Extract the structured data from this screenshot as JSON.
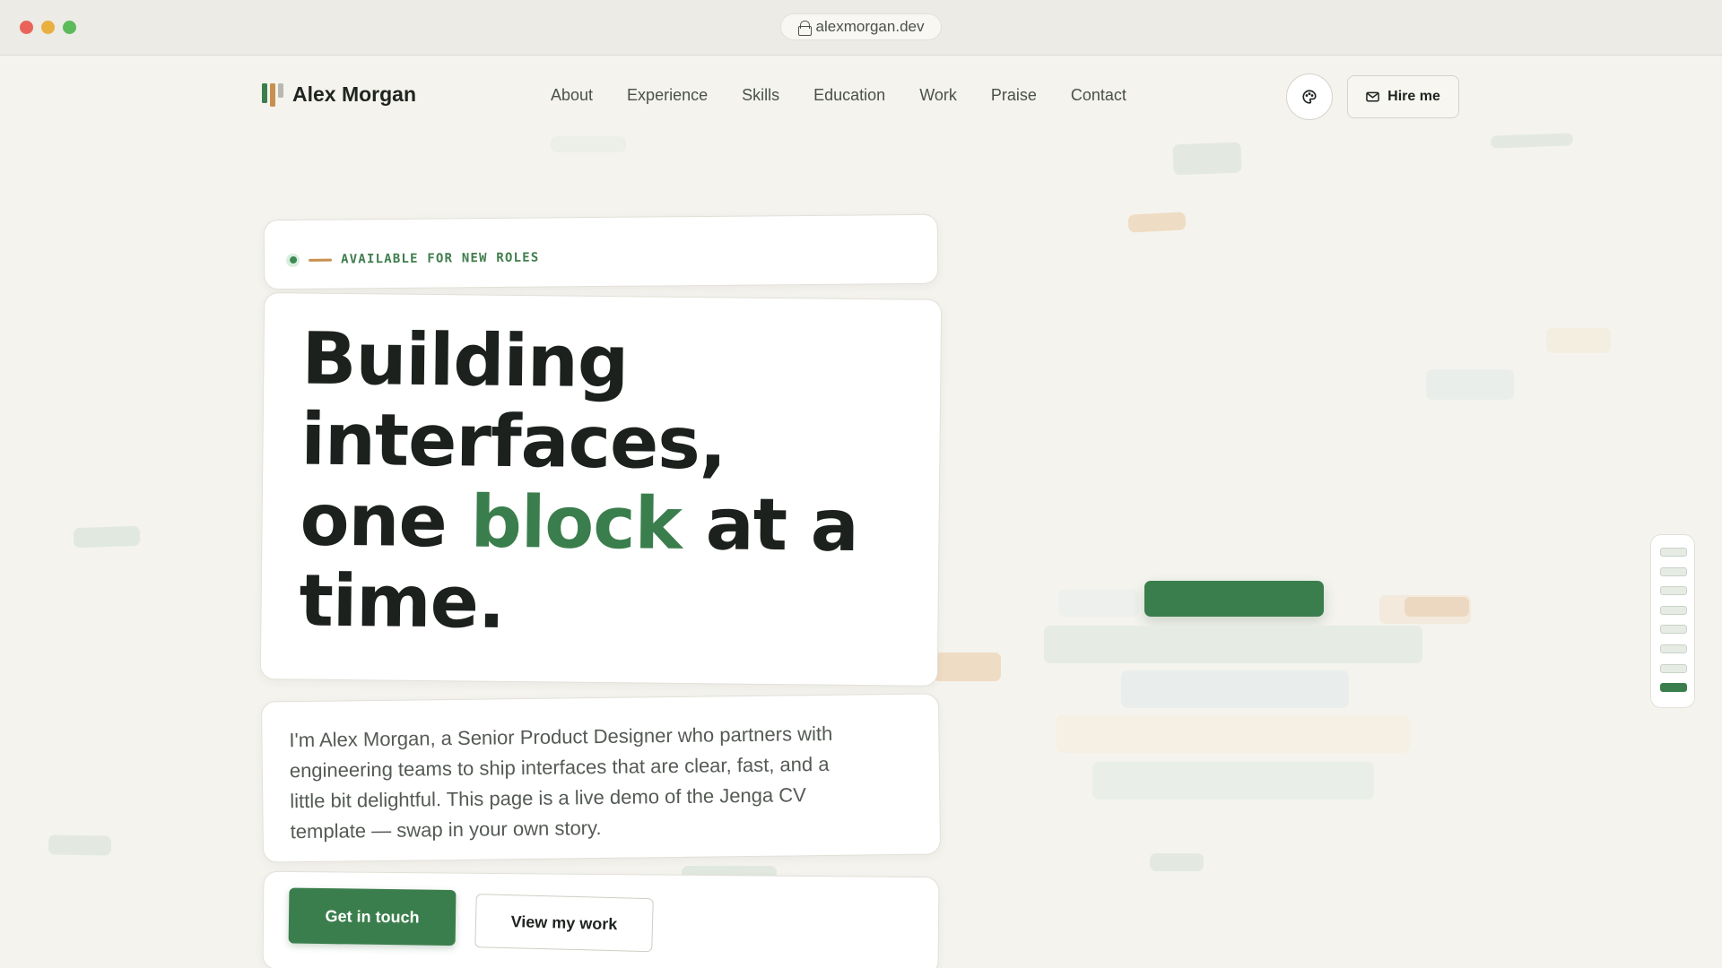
{
  "browser": {
    "url": "alexmorgan.dev"
  },
  "brand": {
    "name": "Alex Morgan",
    "colors": {
      "green": "#3b7e4d",
      "tan": "#c89050",
      "gray": "#b8b8b0"
    }
  },
  "nav": {
    "items": [
      "About",
      "Experience",
      "Skills",
      "Education",
      "Work",
      "Praise",
      "Contact"
    ]
  },
  "header": {
    "palette_icon": "palette-icon",
    "hire_icon": "mail-icon",
    "hire_label": "Hire me"
  },
  "hero": {
    "badge": "AVAILABLE FOR NEW ROLES",
    "headline": {
      "line1": "Building",
      "line2": "interfaces,",
      "line3_pre": "one ",
      "line3_accent": "block",
      "line3_post": " at a",
      "line4": "time."
    },
    "description": "I'm Alex Morgan, a Senior Product Designer who partners with engineering teams to ship interfaces that are clear, fast, and a little bit delightful. This page is a live demo of the Jenga CV template — swap in your own story.",
    "primary_cta": "Get in touch",
    "secondary_cta": "View my work"
  },
  "stack_indicator": {
    "total": 8,
    "active_index": 7
  }
}
